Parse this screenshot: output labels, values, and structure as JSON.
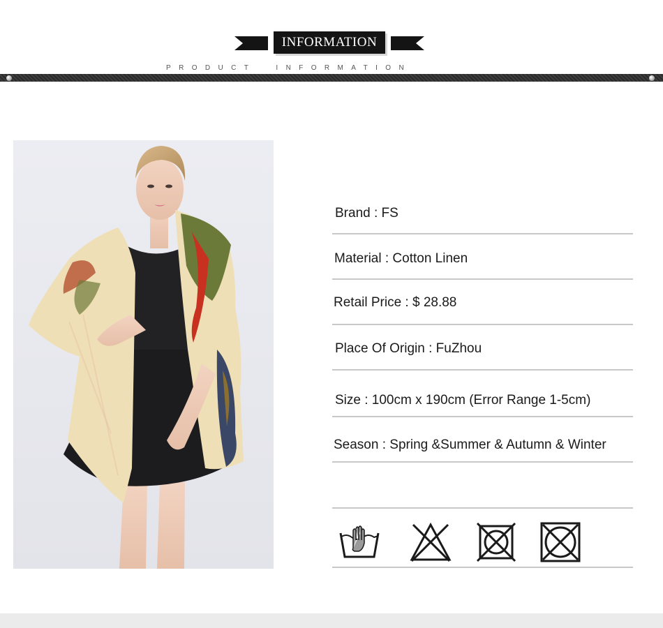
{
  "header": {
    "title": "INFORMATION",
    "subtitle": "PRODUCT  INFORMATION"
  },
  "product_image": {
    "description_icon": "model-wearing-scarf-photo"
  },
  "info": [
    {
      "label": "Brand",
      "value": "FS",
      "text": "Brand : FS"
    },
    {
      "label": "Material",
      "value": "Cotton Linen",
      "text": "Material :  Cotton Linen"
    },
    {
      "label": "Retail Price",
      "value": "$ 28.88",
      "text": "Retail Price : $ 28.88"
    },
    {
      "label": "Place Of Origin",
      "value": "FuZhou",
      "text": "Place Of Origin : FuZhou"
    },
    {
      "label": "Size",
      "value": "100cm x 190cm (Error Range 1-5cm)",
      "text": "Size : 100cm x 190cm (Error Range 1-5cm)"
    },
    {
      "label": "Season",
      "value": "Spring &Summer & Autumn & Winter",
      "text": "Season : Spring &Summer & Autumn & Winter"
    }
  ],
  "care_icons": [
    "hand-wash-icon",
    "no-bleach-icon",
    "no-tumble-dry-icon",
    "no-dry-clean-icon"
  ],
  "colors": {
    "header_bar": "#141414",
    "divider": "#c8c8c8",
    "photo_background": "#e8e8ee",
    "scarf_base": "#eedfb8",
    "footer": "#ebebeb"
  }
}
